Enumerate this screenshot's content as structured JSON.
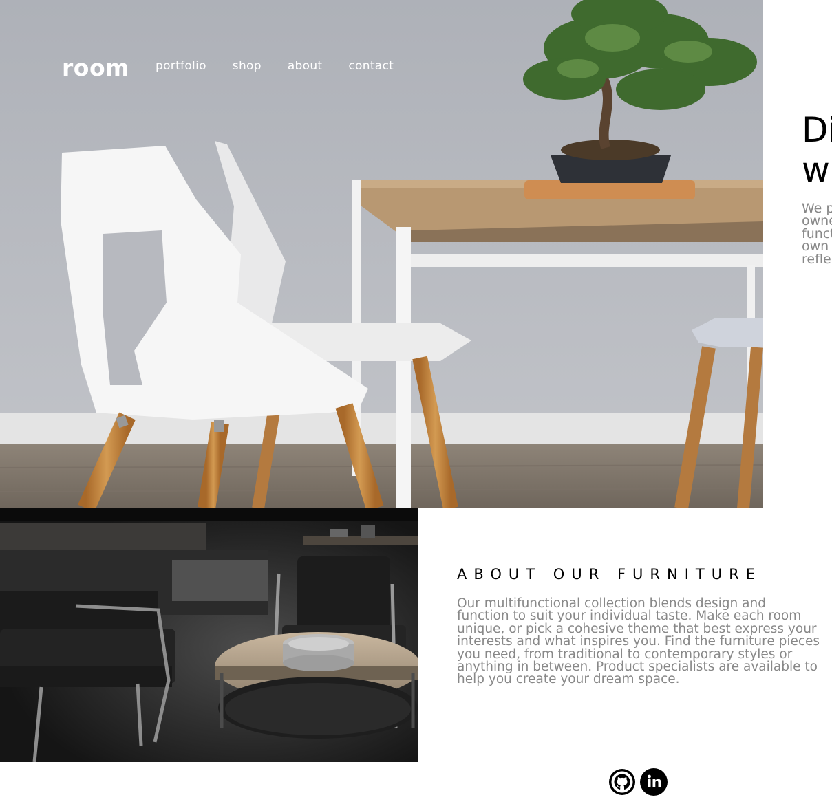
{
  "nav": {
    "logo": "room",
    "links": [
      "portfolio",
      "shop",
      "about",
      "contact"
    ]
  },
  "hero": {
    "title_visible": "Di\nw",
    "description_visible": "We p\nowne\nfunct\nown\nrefle"
  },
  "about": {
    "title": "ABOUT OUR FURNITURE",
    "body": "Our multifunctional collection blends design and function to suit your individual taste. Make each room unique, or pick a cohesive theme that best express your interests and what inspires you. Find the furniture pieces you need, from traditional to contemporary styles or anything in between. Product specialists are available to help you create your dream space."
  },
  "social": {
    "icons": [
      "github-icon",
      "linkedin-icon"
    ]
  },
  "colors": {
    "text_dark": "#000000",
    "text_gray": "#888888",
    "nav_text": "#ffffff"
  }
}
